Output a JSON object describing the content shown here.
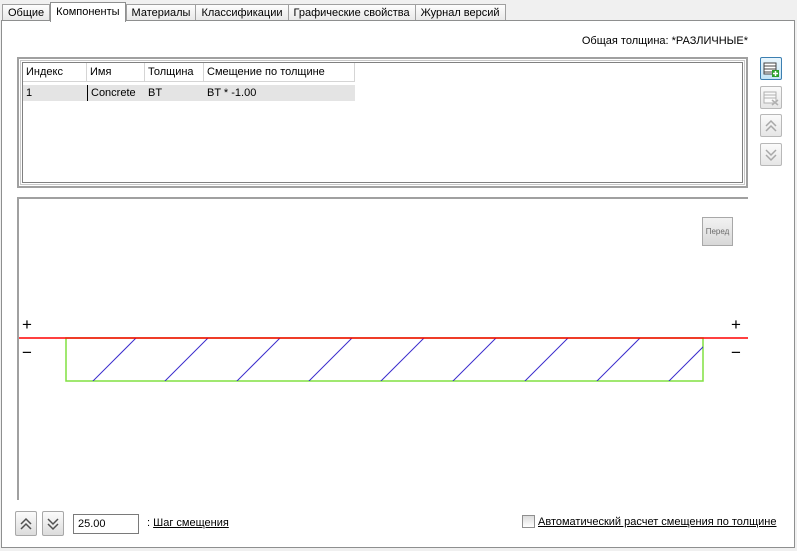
{
  "tabs": [
    {
      "label": "Общие"
    },
    {
      "label": "Компоненты",
      "active": true
    },
    {
      "label": "Материалы"
    },
    {
      "label": "Классификации"
    },
    {
      "label": "Графические свойства"
    },
    {
      "label": "Журнал версий"
    }
  ],
  "total_thickness": "Общая толщина: *РАЗЛИЧНЫЕ*",
  "grid": {
    "headers": [
      "Индекс",
      "Имя",
      "Толщина",
      "Смещение по толщине"
    ],
    "rows": [
      {
        "index": "1",
        "name": "Concrete",
        "thickness": "BT",
        "offset": "BT * -1.00"
      }
    ]
  },
  "preview": {
    "front_button": "Перед",
    "plus": "+",
    "minus": "−",
    "colors": {
      "reference": "#ff0000",
      "outline": "#80e040",
      "hatch": "#3a2ccc"
    }
  },
  "offset_step": {
    "value": "25.00",
    "colon": ": ",
    "label": "Шаг смещения"
  },
  "auto_offset": {
    "label": "Автоматический расчет смещения по толщине",
    "checked": false
  }
}
